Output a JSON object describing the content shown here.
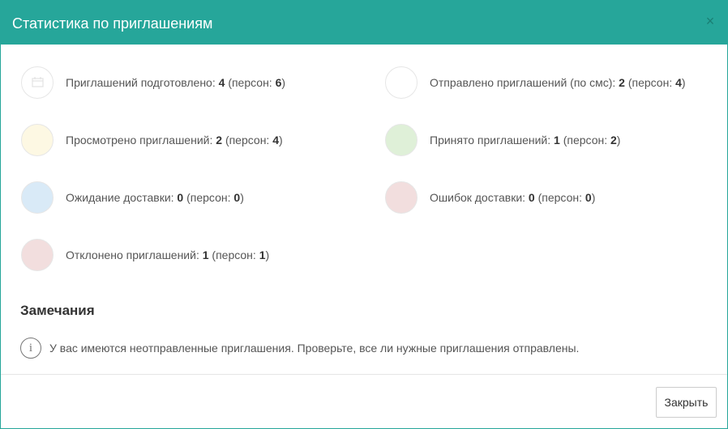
{
  "dialog": {
    "title": "Статистика по приглашениям",
    "close_icon": "×"
  },
  "stats": [
    {
      "label": "Приглашений подготовлено:",
      "count": "4",
      "persons_label": "(персон:",
      "persons": "6",
      "suffix": ")",
      "color": "#ffffff",
      "icon": "calendar-icon"
    },
    {
      "label": "Отправлено приглашений (по смс):",
      "count": "2",
      "persons_label": "(персон:",
      "persons": "4",
      "suffix": ")",
      "color": "#ffffff"
    },
    {
      "label": "Просмотрено приглашений:",
      "count": "2",
      "persons_label": "(персон:",
      "persons": "4",
      "suffix": ")",
      "color": "#fdf8e3"
    },
    {
      "label": "Принято приглашений:",
      "count": "1",
      "persons_label": "(персон:",
      "persons": "2",
      "suffix": ")",
      "color": "#dff0d8"
    },
    {
      "label": "Ожидание доставки:",
      "count": "0",
      "persons_label": "(персон:",
      "persons": "0",
      "suffix": ")",
      "color": "#d9eaf7"
    },
    {
      "label": "Ошибок доставки:",
      "count": "0",
      "persons_label": "(персон:",
      "persons": "0",
      "suffix": ")",
      "color": "#f2dede"
    },
    {
      "label": "Отклонено приглашений:",
      "count": "1",
      "persons_label": "(персон:",
      "persons": "1",
      "suffix": ")",
      "color": "#f2dede"
    }
  ],
  "notes": {
    "title": "Замечания",
    "info_glyph": "i",
    "text": "У вас имеются неотправленные приглашения. Проверьте, все ли нужные приглашения отправлены."
  },
  "footer": {
    "close_label": "Закрыть"
  }
}
